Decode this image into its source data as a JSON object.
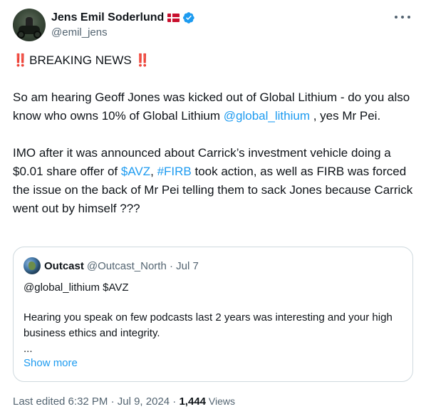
{
  "author": {
    "display_name": "Jens Emil Soderlund",
    "handle": "@emil_jens",
    "flag_icon": "denmark-flag-icon",
    "verified_color": "#1d9bf0"
  },
  "tweet": {
    "headline_bang_left": "‼️",
    "headline": "BREAKING NEWS",
    "headline_bang_right": "‼️",
    "p1_part1": "So am hearing Geoff Jones was kicked out of Global Lithium - do you also know who owns 10% of Global Lithium ",
    "p1_mention": "@global_lithium",
    "p1_part2": " , yes Mr Pei.",
    "p2_part1": "IMO after it was announced about Carrick’s  investment vehicle doing a $0.01 share offer of ",
    "p2_cashtag": "$AVZ",
    "p2_part2": ",  ",
    "p2_hashtag": "#FIRB",
    "p2_part3": " took action, as well as FIRB was forced the issue on the back of Mr Pei telling them to sack Jones because Carrick went out by himself ???"
  },
  "quote": {
    "display_name": "Outcast",
    "handle_date": "@Outcast_North · Jul 7",
    "line1": "@global_lithium $AVZ",
    "line2": "Hearing you speak on few podcasts last 2 years was interesting and your high business ethics and integrity.",
    "ellipsis": "...",
    "show_more": "Show more"
  },
  "meta": {
    "edited": "Last edited 6:32 PM · Jul 9, 2024 · ",
    "views_count": "1,444",
    "views_label": " Views"
  },
  "colors": {
    "link": "#1d9bf0",
    "secondary_text": "#536471",
    "border": "#cfd9de"
  }
}
